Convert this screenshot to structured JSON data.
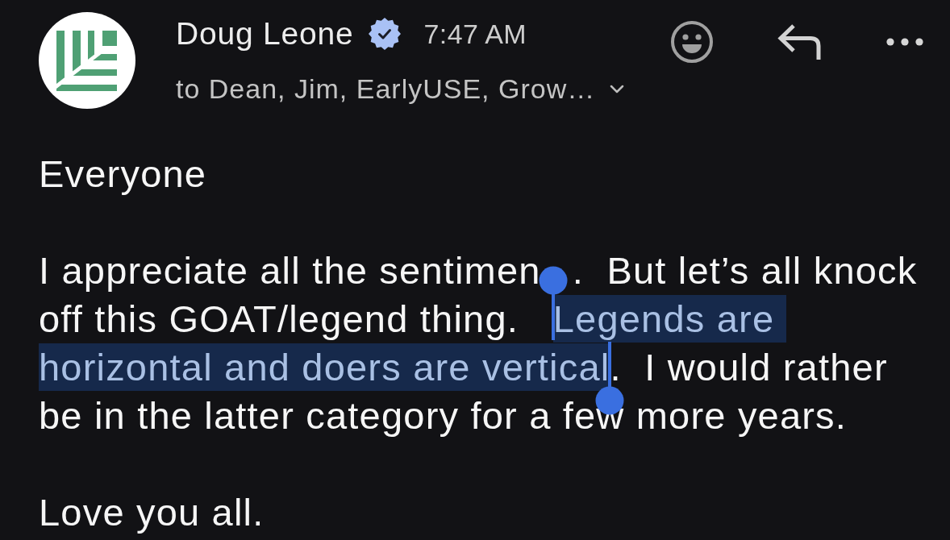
{
  "sender": {
    "name": "Doug Leone",
    "verified": true,
    "time": "7:47 AM",
    "recipients": "to Dean, Jim, EarlyUSE, Grow…"
  },
  "body": [
    {
      "text": "Everyone"
    },
    {
      "segments": [
        {
          "kind": "text",
          "text": "I appreciate all the sentimen",
          "selected": false
        },
        {
          "kind": "covered",
          "selected": false
        },
        {
          "kind": "text",
          "text": ".  But let’s all knock off this GOAT/legend thing.   ",
          "selected": false
        },
        {
          "kind": "text",
          "text": "Legends are horizontal and doers are vertical",
          "selected": true
        },
        {
          "kind": "text",
          "text": ".  I would rather be in the latter category for a few more years.",
          "selected": false
        }
      ]
    },
    {
      "text": "Love you all."
    }
  ]
}
